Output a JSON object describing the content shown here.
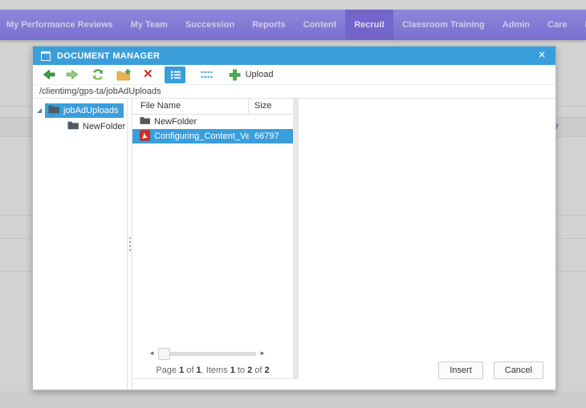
{
  "page": {
    "nav_items": [
      {
        "label": "My Performance Reviews"
      },
      {
        "label": "My Team"
      },
      {
        "label": "Succession"
      },
      {
        "label": "Reports"
      },
      {
        "label": "Content"
      },
      {
        "label": "Recruit"
      },
      {
        "label": "Classroom Training"
      },
      {
        "label": "Admin"
      },
      {
        "label": "Care"
      },
      {
        "label": "Inte"
      }
    ],
    "active_nav": "Recruit",
    "background_partial_text": "w"
  },
  "dialog": {
    "title": "DOCUMENT MANAGER",
    "icons": {
      "close_glyph": "✕",
      "delete_glyph": "✕",
      "scroll_left_glyph": "◄",
      "scroll_right_glyph": "►"
    },
    "toolbar": {
      "upload_label": "Upload"
    },
    "path": "/clientimg/gps-ta/jobAdUploads",
    "tree": {
      "root_label": "jobAdUploads",
      "child_label": "NewFolder"
    },
    "grid": {
      "columns": {
        "name": "File Name",
        "size": "Size"
      },
      "rows": [
        {
          "name": "NewFolder",
          "size": "",
          "type": "folder"
        },
        {
          "name": "Configuring_Content_Vendo",
          "size": "66797",
          "type": "pdf"
        }
      ],
      "pager": {
        "t1": "Page ",
        "n1": "1",
        "t2": " of ",
        "n2": "1",
        "t3": ". Items ",
        "n3": "1",
        "t4": " to ",
        "n4": "2",
        "t5": " of ",
        "n5": "2"
      }
    },
    "buttons": {
      "insert": "Insert",
      "cancel": "Cancel"
    }
  }
}
